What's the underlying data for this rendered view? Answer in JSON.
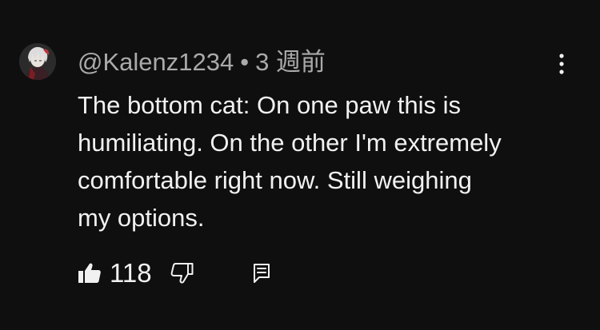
{
  "comment": {
    "author": "@Kalenz1234",
    "separator": "•",
    "timestamp": "3 週前",
    "text": "The bottom cat: On one paw this is\nhumiliating. On the other I'm extremely\ncomfortable right now. Still weighing\nmy options.",
    "like_count": "118"
  },
  "icons": {
    "avatar": "anime-avatar",
    "more": "vertical-dots-icon",
    "like": "thumbs-up-filled-icon",
    "dislike": "thumbs-down-outline-icon",
    "reply": "reply-comment-icon"
  },
  "colors": {
    "background": "#0f0f0f",
    "primary_text": "#f1f1f1",
    "secondary_text": "#aaaaaa"
  }
}
